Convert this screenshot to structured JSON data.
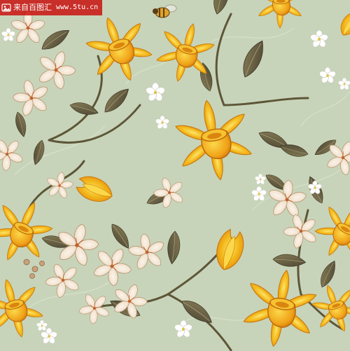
{
  "image": {
    "subject": "Seamless floral pattern with yellow daffodils, cream blossoms and small white flowers on a pale sage background",
    "colors": {
      "background": "#c8d4b9",
      "background_leaf_texture": "#d8e2cc",
      "daffodil_yellow": "#f2b719",
      "daffodil_light": "#fbd84a",
      "daffodil_orange": "#e88b14",
      "blossom_cream": "#f5eadb",
      "blossom_shadow": "#d9bfa0",
      "leaf_olive": "#6b6244",
      "leaf_dark": "#4a4431",
      "stem_brown": "#5d5638",
      "white_flower": "#ffffff"
    }
  },
  "watermark": {
    "site_name": "来自百图汇",
    "url": "www.5tu.cn",
    "icon": "image-icon",
    "color": "#c80000"
  }
}
